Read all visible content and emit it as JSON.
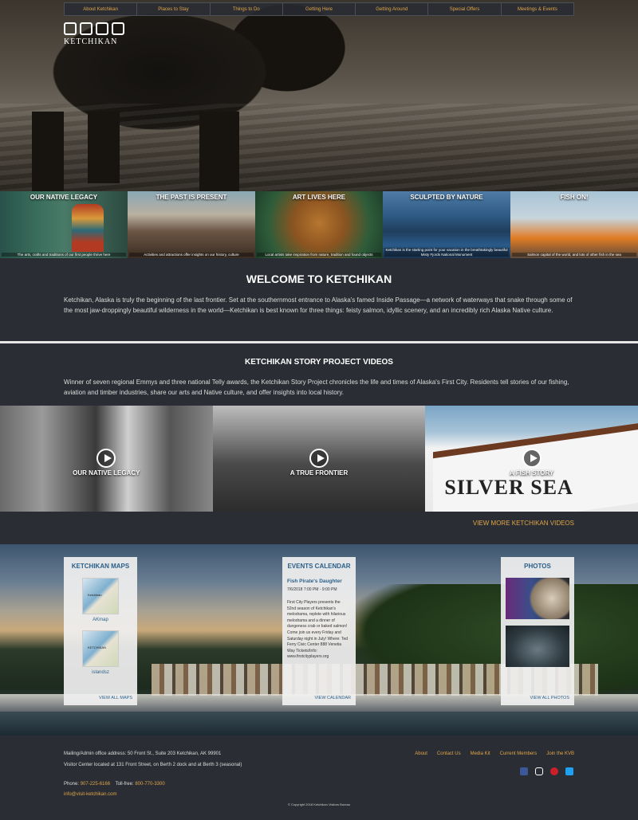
{
  "nav": [
    "About Ketchikan",
    "Places to Stay",
    "Things to Do",
    "Getting Here",
    "Getting Around",
    "Special Offers",
    "Meetings & Events"
  ],
  "logo": {
    "text": "KETCHIKAN"
  },
  "tiles": [
    {
      "title": "OUR NATIVE LEGACY",
      "caption": "The arts, crafts and traditions of our first people thrive here"
    },
    {
      "title": "THE PAST IS PRESENT",
      "caption": "Activities and attractions offer insights on our history, culture"
    },
    {
      "title": "ART LIVES HERE",
      "caption": "Local artists take inspiration from nature, tradition and found objects"
    },
    {
      "title": "SCULPTED BY NATURE",
      "caption": "Ketchikan is the starting point for your vacation in the breathtakingly beautiful Misty Fjords National Monument"
    },
    {
      "title": "FISH ON!",
      "caption": "Salmon capital of the world, and lots of other fish in the sea"
    }
  ],
  "welcome": {
    "heading": "WELCOME TO KETCHIKAN",
    "body": "Ketchikan, Alaska is truly the beginning of the last frontier. Set at the southernmost entrance to Alaska's famed Inside Passage—a network of waterways that snake through some of the most jaw-droppingly beautiful wilderness in the world—Ketchikan is best known for three things: feisty salmon, idyllic scenery, and an incredibly rich Alaska Native culture."
  },
  "videos": {
    "heading": "KETCHIKAN STORY PROJECT VIDEOS",
    "body": "Winner of seven regional Emmys and three national Telly awards, the Ketchikan Story Project chronicles the life and times of Alaska's First City. Residents tell stories of our fishing, aviation and timber industries, share our arts and Native culture, and offer insights into local history.",
    "items": [
      "OUR NATIVE LEGACY",
      "A TRUE FRONTIER",
      "A FISH STORY"
    ],
    "ship_name": "SILVER SEA",
    "more": "VIEW MORE KETCHIKAN VIDEOS"
  },
  "maps": {
    "title": "KETCHIKAN MAPS",
    "items": [
      {
        "thumb_label": "Ketchikan",
        "caption": "AKmap"
      },
      {
        "thumb_label": "KETCHIKAN",
        "caption": "islandsz"
      }
    ],
    "footer": "VIEW ALL MAPS"
  },
  "events": {
    "title": "EVENTS CALENDAR",
    "event_title": "Fish Pirate's Daughter",
    "event_date": "7/6/2018 7:00 PM - 9:00 PM",
    "event_desc": "First City Players presents the 52nd season of Ketchikan's melodrama, replete with hilarious melodrama and a dinner of dungeness crab or baked salmon! Come join us every Friday and Saturday night in July! Where: Ted Ferry Civic Center 888 Venetia Way Tickets/Info: www.firstcityplayers.org",
    "footer": "VIEW CALENDAR"
  },
  "photos": {
    "title": "PHOTOS",
    "footer": "VIEW ALL PHOTOS"
  },
  "footer": {
    "address1": "Mailing/Admin office address: 50 Front St., Suite 203 Ketchikan, AK 99901",
    "address2": "Visitor Center located at 131 Front Street, on Berth 2 dock and at Berth 3 (seasonal)",
    "phone_label": "Phone:",
    "phone": "907-225-6166",
    "tollfree_label": "Toll-free:",
    "tollfree": "800-770-3300",
    "email": "info@visit-ketchikan.com",
    "links": [
      "About",
      "Contact Us",
      "Media Kit",
      "Current Members",
      "Join the KVB"
    ],
    "social": [
      {
        "icon": "facebook-icon",
        "color": "#3b5998"
      },
      {
        "icon": "instagram-icon",
        "color": "#ffffff"
      },
      {
        "icon": "pinterest-icon",
        "color": "#cb2027"
      },
      {
        "icon": "twitter-icon",
        "color": "#1da1f2"
      }
    ],
    "copyright": "© Copyright 2018 Ketchikan Visitors Bureau"
  },
  "colors": {
    "accent": "#e0a64a",
    "background": "#2a2d33",
    "link_blue": "#2a5f8a"
  }
}
